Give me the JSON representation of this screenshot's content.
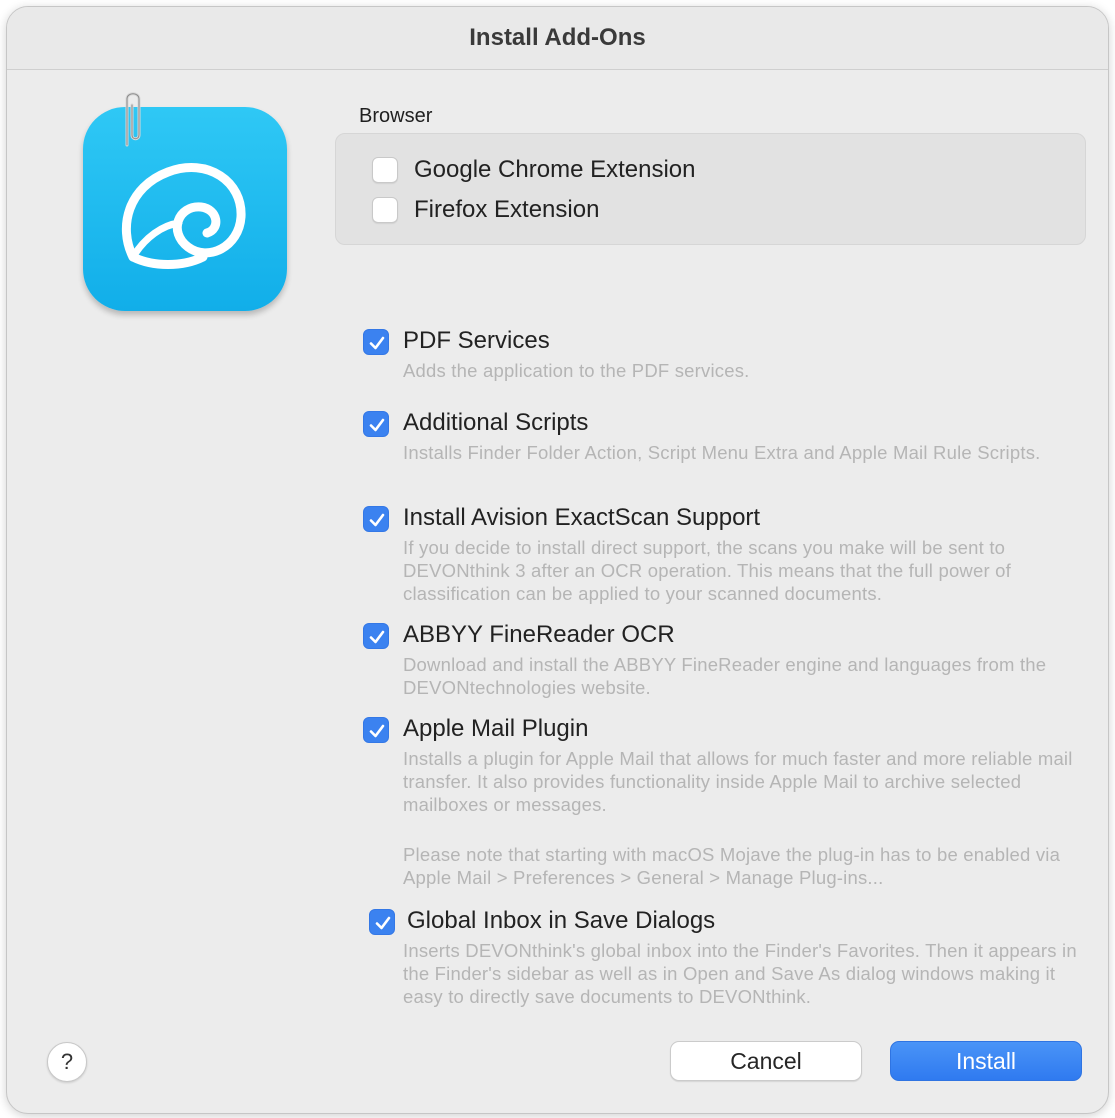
{
  "window": {
    "title": "Install Add-Ons"
  },
  "colors": {
    "accent": "#3b82f0",
    "icon_blue": "#1bb8f0"
  },
  "browser": {
    "label": "Browser",
    "items": [
      {
        "label": "Google Chrome Extension",
        "checked": false
      },
      {
        "label": "Firefox Extension",
        "checked": false
      }
    ]
  },
  "options": [
    {
      "label": "PDF Services",
      "checked": true,
      "description": "Adds the application to the PDF services."
    },
    {
      "label": "Additional Scripts",
      "checked": true,
      "description": "Installs Finder Folder Action, Script Menu Extra and Apple Mail Rule Scripts."
    },
    {
      "label": "Install Avision ExactScan Support",
      "checked": true,
      "description": "If you decide to install direct support, the scans you make will be sent to DEVONthink 3 after an OCR operation. This means that the full power of classification can be applied to your scanned documents."
    },
    {
      "label": "ABBYY FineReader OCR",
      "checked": true,
      "description": "Download and install the ABBYY FineReader engine and languages from the DEVONtechnologies website."
    },
    {
      "label": "Apple Mail Plugin",
      "checked": true,
      "description": "Installs a plugin for Apple Mail that allows for much faster and more reliable mail transfer. It also provides functionality inside Apple Mail to archive selected mailboxes or messages.",
      "note": "Please note that starting with macOS Mojave the plug-in has to be enabled via Apple Mail > Preferences > General > Manage Plug-ins..."
    },
    {
      "label": "Global Inbox in Save Dialogs",
      "checked": true,
      "description": "Inserts DEVONthink's global inbox into the Finder's Favorites. Then it appears in the Finder's sidebar as well as in Open and Save As dialog windows making it easy to directly save documents to DEVONthink."
    }
  ],
  "footer": {
    "help_label": "?",
    "cancel_label": "Cancel",
    "install_label": "Install"
  },
  "icons": {
    "app": "shell-icon",
    "clip": "paperclip-icon",
    "check": "checkmark-icon"
  }
}
